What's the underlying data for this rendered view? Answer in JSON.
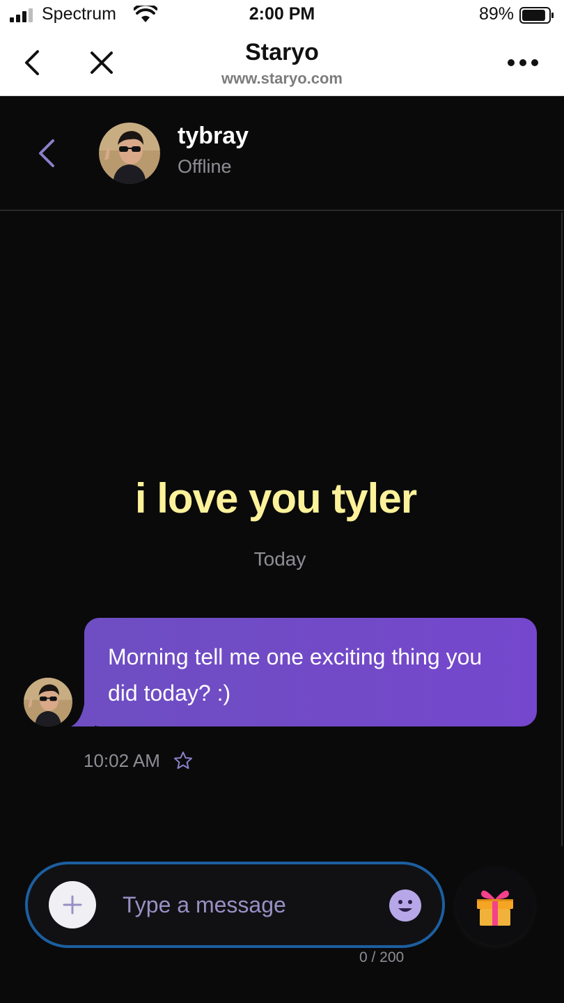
{
  "status_bar": {
    "carrier": "Spectrum",
    "time": "2:00 PM",
    "battery_percent": "89%",
    "battery_level": 0.89,
    "icons": [
      "signal-icon",
      "wifi-icon",
      "battery-icon"
    ]
  },
  "browser": {
    "title": "Staryo",
    "url": "www.staryo.com",
    "icons": [
      "back-chevron-icon",
      "close-icon",
      "more-dots-icon"
    ]
  },
  "chat_header": {
    "contact_name": "tybray",
    "contact_status": "Offline",
    "icons": [
      "back-chevron-icon",
      "avatar"
    ]
  },
  "chat": {
    "banner_text": "i love you tyler",
    "date_separator": "Today",
    "messages": [
      {
        "text": "Morning tell me one exciting thing you did today? :)",
        "time": "10:02 AM",
        "starred": false
      }
    ]
  },
  "composer": {
    "placeholder": "Type a message",
    "value": "",
    "char_count": "0 / 200",
    "icons": [
      "plus-icon",
      "emoji-icon",
      "gift-icon"
    ]
  },
  "colors": {
    "background": "#0a0a0b",
    "banner_text": "#fdf29a",
    "bubble_start": "#6e4ec2",
    "bubble_end": "#7547cc",
    "composer_border": "#1c5fa0",
    "accent_purple": "#9a8fc4"
  }
}
